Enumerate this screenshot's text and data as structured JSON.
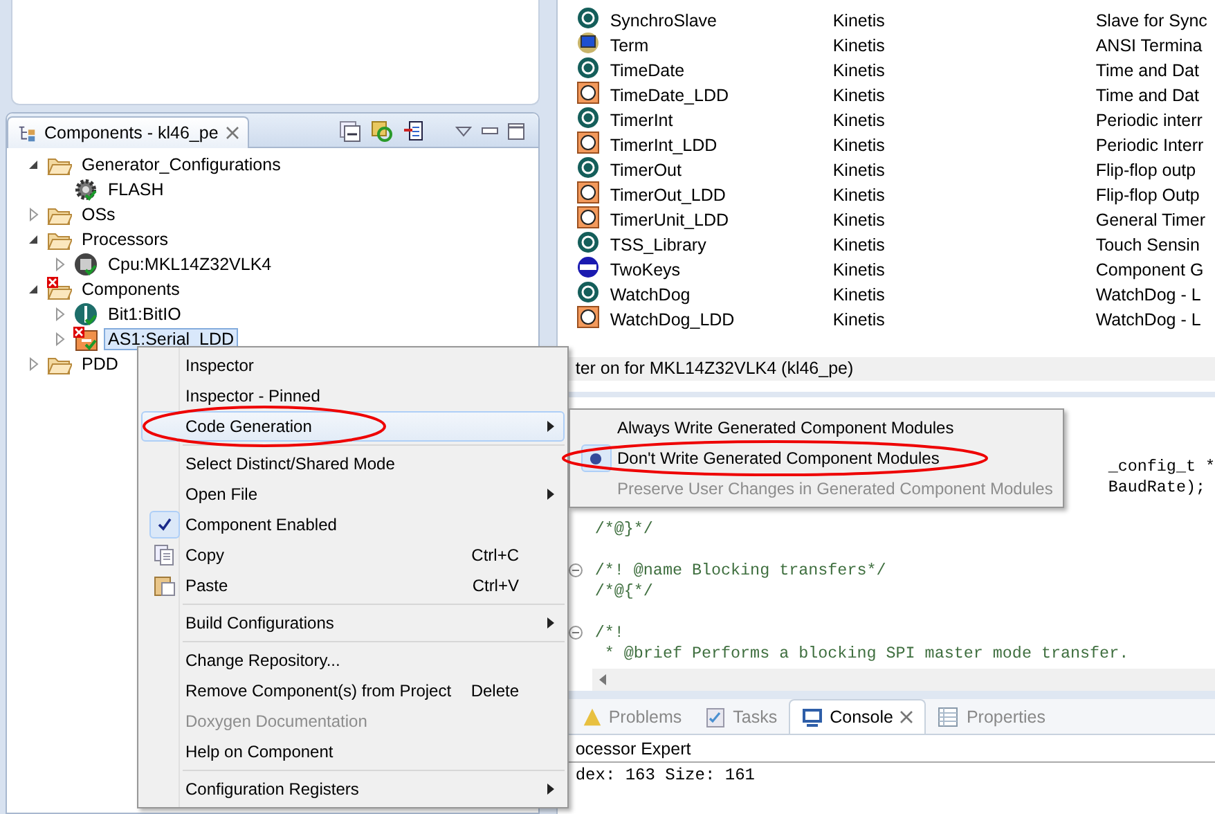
{
  "components_view": {
    "tab": {
      "title": "Components - kl46_pe"
    },
    "tree": [
      {
        "label": "Generator_Configurations",
        "kind": "folder",
        "expanded": true,
        "selected": false,
        "error": false,
        "children": [
          {
            "label": "FLASH",
            "kind": "configuration",
            "selected": false,
            "error": false
          }
        ]
      },
      {
        "label": "OSs",
        "kind": "folder",
        "expanded": false,
        "selected": false,
        "error": false
      },
      {
        "label": "Processors",
        "kind": "folder",
        "expanded": true,
        "selected": false,
        "error": false,
        "children": [
          {
            "label": "Cpu:MKL14Z32VLK4",
            "kind": "processor",
            "expanded": false,
            "selected": false,
            "error": false
          }
        ]
      },
      {
        "label": "Components",
        "kind": "folder",
        "expanded": true,
        "selected": false,
        "error": true,
        "children": [
          {
            "label": "Bit1:BitIO",
            "kind": "component",
            "expanded": false,
            "selected": false,
            "error": false
          },
          {
            "label": "AS1:Serial_LDD",
            "kind": "ldd",
            "expanded": false,
            "selected": true,
            "error": true
          }
        ]
      },
      {
        "label": "PDD",
        "kind": "folder",
        "expanded": false,
        "selected": false,
        "error": false
      }
    ]
  },
  "component_table": {
    "rows": [
      {
        "name": "SynchroSlave",
        "category": "Kinetis",
        "description": "Slave for Sync",
        "kind": "round"
      },
      {
        "name": "Term",
        "category": "Kinetis",
        "description": "ANSI Termina",
        "kind": "terminal"
      },
      {
        "name": "TimeDate",
        "category": "Kinetis",
        "description": "Time and Dat",
        "kind": "round"
      },
      {
        "name": "TimeDate_LDD",
        "category": "Kinetis",
        "description": "Time and Dat",
        "kind": "square"
      },
      {
        "name": "TimerInt",
        "category": "Kinetis",
        "description": "Periodic interr",
        "kind": "round"
      },
      {
        "name": "TimerInt_LDD",
        "category": "Kinetis",
        "description": "Periodic Interr",
        "kind": "square"
      },
      {
        "name": "TimerOut",
        "category": "Kinetis",
        "description": "Flip-flop outp",
        "kind": "round"
      },
      {
        "name": "TimerOut_LDD",
        "category": "Kinetis",
        "description": "Flip-flop Outp",
        "kind": "square"
      },
      {
        "name": "TimerUnit_LDD",
        "category": "Kinetis",
        "description": "General Timer",
        "kind": "square"
      },
      {
        "name": "TSS_Library",
        "category": "Kinetis",
        "description": "Touch Sensin",
        "kind": "round"
      },
      {
        "name": "TwoKeys",
        "category": "Kinetis",
        "description": "Component G",
        "kind": "user"
      },
      {
        "name": "WatchDog",
        "category": "Kinetis",
        "description": "WatchDog - L",
        "kind": "round"
      },
      {
        "name": "WatchDog_LDD",
        "category": "Kinetis",
        "description": "WatchDog - L",
        "kind": "square"
      }
    ]
  },
  "status_line": "ter on for MKL14Z32VLK4 (kl46_pe)",
  "editor": {
    "lines": [
      {
        "text": "_config_t *",
        "kind": "partial"
      },
      {
        "text": "BaudRate);",
        "kind": "partial"
      },
      {
        "kind": "blank"
      },
      {
        "text": "/*@}*/",
        "kind": "comment",
        "foldable": false
      },
      {
        "kind": "blank"
      },
      {
        "text": "/*! @name Blocking transfers*/",
        "kind": "comment",
        "foldable": true
      },
      {
        "text": "/*@{*/",
        "kind": "comment",
        "foldable": false
      },
      {
        "kind": "blank"
      },
      {
        "text": "/*!",
        "kind": "comment",
        "foldable": true
      },
      {
        "text": " * @brief Performs a blocking SPI master mode transfer.",
        "kind": "comment",
        "foldable": false
      }
    ]
  },
  "bottom_panel": {
    "tabs": [
      {
        "label": "Problems",
        "kind": "problems",
        "selected": false
      },
      {
        "label": "Tasks",
        "kind": "tasks",
        "selected": false
      },
      {
        "label": "Console",
        "kind": "console",
        "selected": true
      },
      {
        "label": "Properties",
        "kind": "properties",
        "selected": false
      }
    ],
    "console_title": "ocessor Expert",
    "console_lines": [
      "dex: 163 Size: 161"
    ]
  },
  "context_menu": {
    "items": [
      {
        "kind": "item",
        "label": "Inspector",
        "submenu": false,
        "checked": false,
        "disabled": false,
        "highlighted": false
      },
      {
        "kind": "item",
        "label": "Inspector - Pinned",
        "submenu": false,
        "checked": false,
        "disabled": false,
        "highlighted": false
      },
      {
        "kind": "item",
        "label": "Code Generation",
        "submenu": true,
        "checked": false,
        "disabled": false,
        "highlighted": true
      },
      {
        "kind": "separator"
      },
      {
        "kind": "item",
        "label": "Select Distinct/Shared Mode",
        "submenu": false,
        "checked": false,
        "disabled": false,
        "highlighted": false
      },
      {
        "kind": "item",
        "label": "Open File",
        "submenu": true,
        "checked": false,
        "disabled": false,
        "highlighted": false
      },
      {
        "kind": "item",
        "label": "Component Enabled",
        "submenu": false,
        "checked": true,
        "disabled": false,
        "highlighted": false
      },
      {
        "kind": "copy",
        "label": "Copy",
        "shortcut": "Ctrl+C",
        "submenu": false,
        "checked": false,
        "disabled": false,
        "highlighted": false
      },
      {
        "kind": "paste",
        "label": "Paste",
        "shortcut": "Ctrl+V",
        "submenu": false,
        "checked": false,
        "disabled": false,
        "highlighted": false
      },
      {
        "kind": "separator"
      },
      {
        "kind": "item",
        "label": "Build Configurations",
        "submenu": true,
        "checked": false,
        "disabled": false,
        "highlighted": false
      },
      {
        "kind": "separator"
      },
      {
        "kind": "item",
        "label": "Change Repository...",
        "submenu": false,
        "checked": false,
        "disabled": false,
        "highlighted": false
      },
      {
        "kind": "item",
        "label": "Remove Component(s) from Project",
        "shortcut": "Delete",
        "submenu": false,
        "checked": false,
        "disabled": false,
        "highlighted": false
      },
      {
        "kind": "item",
        "label": "Doxygen Documentation",
        "submenu": false,
        "checked": false,
        "disabled": true,
        "highlighted": false
      },
      {
        "kind": "item",
        "label": "Help on Component",
        "submenu": false,
        "checked": false,
        "disabled": false,
        "highlighted": false
      },
      {
        "kind": "separator"
      },
      {
        "kind": "item",
        "label": "Configuration Registers",
        "submenu": true,
        "checked": false,
        "disabled": false,
        "highlighted": false
      }
    ]
  },
  "submenu": {
    "items": [
      {
        "label": "Always Write Generated Component Modules",
        "selected": false,
        "disabled": false
      },
      {
        "label": "Don't Write Generated Component Modules",
        "selected": true,
        "disabled": false
      },
      {
        "label": "Preserve User Changes in Generated Component Modules",
        "selected": false,
        "disabled": true
      }
    ]
  }
}
